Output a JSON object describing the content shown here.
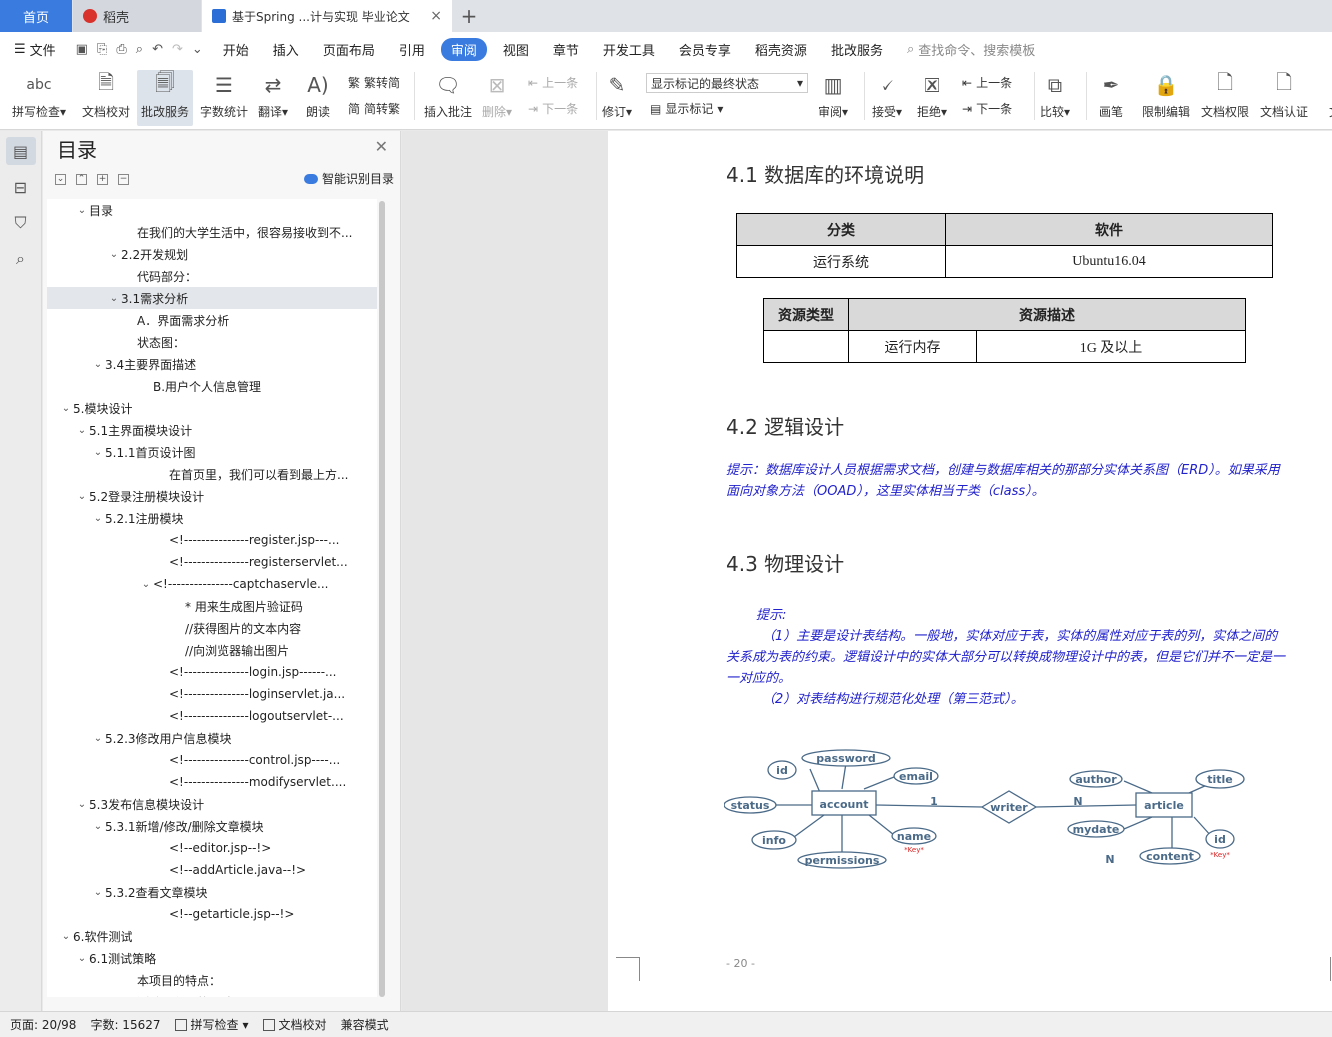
{
  "tabs": {
    "home": "首页",
    "daoke": "稻壳",
    "doc": "基于Spring ...计与实现 毕业论文"
  },
  "menu": {
    "file": "文件",
    "items": [
      "开始",
      "插入",
      "页面布局",
      "引用",
      "审阅",
      "视图",
      "章节",
      "开发工具",
      "会员专享",
      "稻壳资源",
      "批改服务"
    ],
    "active": "审阅",
    "search": "查找命令、搜索模板"
  },
  "ribbon": {
    "spell": "拼写检查",
    "proofread": "文档校对",
    "review_service": "批改服务",
    "wordcount": "字数统计",
    "translate": "翻译",
    "read": "朗读",
    "trad": "繁转简",
    "simp": "简转繁",
    "insert_comment": "插入批注",
    "delete": "删除",
    "prev": "上一条",
    "next": "下一条",
    "revise": "修订",
    "markup_state": "显示标记的最终状态",
    "show_markup": "显示标记",
    "review": "审阅",
    "accept": "接受",
    "reject": "拒绝",
    "prev2": "上一条",
    "next2": "下一条",
    "compare": "比较",
    "pen": "画笔",
    "restrict": "限制编辑",
    "perm": "文档权限",
    "cert": "文档认证",
    "more": "文"
  },
  "toc": {
    "title": "目录",
    "smart": "智能识别目录",
    "items": [
      {
        "text": "目录",
        "toggle": "v",
        "level": 1
      },
      {
        "text": "在我们的大学生活中，很容易接收到不...",
        "toggle": "",
        "level": 4
      },
      {
        "text": "2.2开发规划",
        "toggle": "v",
        "level": 3
      },
      {
        "text": "代码部分：",
        "toggle": "",
        "level": 4
      },
      {
        "text": "3.1需求分析",
        "toggle": "v",
        "level": 3
      },
      {
        "text": "A．界面需求分析",
        "toggle": "",
        "level": 4
      },
      {
        "text": "状态图：",
        "toggle": "",
        "level": 4
      },
      {
        "text": "3.4主要界面描述",
        "toggle": "v",
        "level": 2
      },
      {
        "text": "B.用户个人信息管理",
        "toggle": "",
        "level": 5
      },
      {
        "text": "5.模块设计",
        "toggle": "v",
        "level": 0
      },
      {
        "text": "5.1主界面模块设计",
        "toggle": "v",
        "level": 1
      },
      {
        "text": "5.1.1首页设计图",
        "toggle": "v",
        "level": 2
      },
      {
        "text": "在首页里，我们可以看到最上方...",
        "toggle": "",
        "level": 6
      },
      {
        "text": "5.2登录注册模块设计",
        "toggle": "v",
        "level": 1
      },
      {
        "text": "5.2.1注册模块",
        "toggle": "v",
        "level": 2
      },
      {
        "text": "<!---------------register.jsp---...",
        "toggle": "",
        "level": 6
      },
      {
        "text": "<!---------------registerservlet...",
        "toggle": "",
        "level": 6
      },
      {
        "text": "<!---------------captchaservle...",
        "toggle": "v",
        "level": 5
      },
      {
        "text": "* 用来生成图片验证码",
        "toggle": "",
        "level": 7
      },
      {
        "text": "//获得图片的文本内容",
        "toggle": "",
        "level": 7
      },
      {
        "text": "//向浏览器输出图片",
        "toggle": "",
        "level": 7
      },
      {
        "text": "<!---------------login.jsp------...",
        "toggle": "",
        "level": 6
      },
      {
        "text": "<!---------------loginservlet.ja...",
        "toggle": "",
        "level": 6
      },
      {
        "text": "<!---------------logoutservlet-...",
        "toggle": "",
        "level": 6
      },
      {
        "text": "5.2.3修改用户信息模块",
        "toggle": "v",
        "level": 2
      },
      {
        "text": "<!---------------control.jsp----...",
        "toggle": "",
        "level": 6
      },
      {
        "text": "<!---------------modifyservlet....",
        "toggle": "",
        "level": 6
      },
      {
        "text": "5.3发布信息模块设计",
        "toggle": "v",
        "level": 1
      },
      {
        "text": "5.3.1新增/修改/删除文章模块",
        "toggle": "v",
        "level": 2
      },
      {
        "text": "<!--editor.jsp--!>",
        "toggle": "",
        "level": 6
      },
      {
        "text": "<!--addArticle.java--!>",
        "toggle": "",
        "level": 6
      },
      {
        "text": "5.3.2查看文章模块",
        "toggle": "v",
        "level": 2
      },
      {
        "text": "<!--getarticle.jsp--!>",
        "toggle": "",
        "level": 6
      },
      {
        "text": "6.软件测试",
        "toggle": "v",
        "level": 0
      },
      {
        "text": "6.1测试策略",
        "toggle": "v",
        "level": 1
      },
      {
        "text": "本项目的特点：",
        "toggle": "",
        "level": 4
      },
      {
        "text": "测试工程量的风险：",
        "toggle": "",
        "level": 4
      }
    ]
  },
  "doc": {
    "h41": "4.1 数据库的环境说明",
    "t1": {
      "h1": "分类",
      "h2": "软件",
      "c1": "运行系统",
      "c2": "Ubuntu16.04"
    },
    "t2": {
      "h1": "资源类型",
      "h2": "资源描述",
      "c1": "",
      "c2": "运行内存",
      "c3": "1G 及以上"
    },
    "h42": "4.2 逻辑设计",
    "hint42": "提示：数据库设计人员根据需求文档，创建与数据库相关的那部分实体关系图（ERD）。如果采用面向对象方法（OOAD），这里实体相当于类（class）。",
    "h43": "4.3 物理设计",
    "hint43_1": "提示:",
    "hint43_2": "（1）主要是设计表结构。一般地，实体对应于表，实体的属性对应于表的列，实体之间的关系成为表的约束。逻辑设计中的实体大部分可以转换成物理设计中的表，但是它们并不一定是一一对应的。",
    "hint43_3": "（2）对表结构进行规范化处理（第三范式）。",
    "page": "- 20 -"
  },
  "erd": {
    "entities": [
      "account",
      "article"
    ],
    "relation": "writer",
    "attrs_left": [
      "id",
      "password",
      "email",
      "status",
      "info",
      "permissions",
      "name"
    ],
    "attrs_right": [
      "author",
      "title",
      "mydate",
      "id",
      "content"
    ],
    "key": "*Key*",
    "card1": "1",
    "cardN1": "N",
    "cardN2": "N"
  },
  "status": {
    "page": "页面: 20/98",
    "words": "字数: 15627",
    "spell": "拼写检查",
    "proof": "文档校对",
    "compat": "兼容模式"
  }
}
